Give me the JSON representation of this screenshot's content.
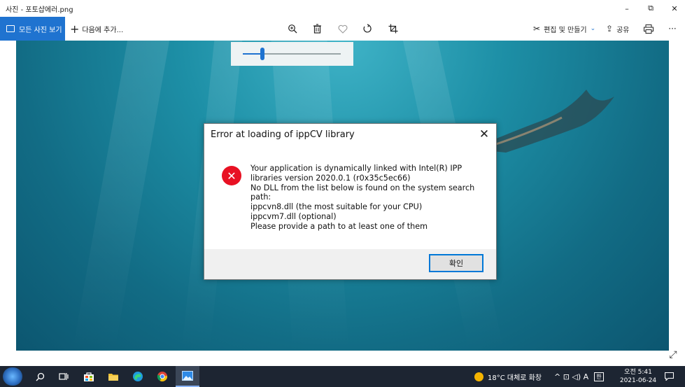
{
  "window": {
    "title": "사진 - 포토샵에러.png",
    "minimize_glyph": "–",
    "maximize_glyph": "⧉",
    "close_glyph": "✕"
  },
  "toolbar": {
    "all_photos_label": "모든 사진 보기",
    "add_to_label": "다음에 추가...",
    "edit_create_label": "편집 및 만들기",
    "share_label": "공유",
    "more_glyph": "···"
  },
  "zoom": {
    "level_fraction": 0.2
  },
  "dialog": {
    "title": "Error at loading of ippCV library",
    "close_glyph": "✕",
    "icon_glyph": "✕",
    "message_lines": [
      "Your application is dynamically linked with Intel(R) IPP",
      "libraries version 2020.0.1 (r0x35c5ec66)",
      "No DLL from the list below is found on the system search",
      "path:",
      "ippcvn8.dll (the most suitable for your CPU)",
      "ippcvm7.dll (optional)",
      "Please provide a path to at least one of them"
    ],
    "ok_label": "확인"
  },
  "expand_glyph": "⤢",
  "taskbar": {
    "weather_text": "18°C  대체로 화창",
    "tray_glyphs": "^  ⊡  ◁)  A",
    "time": "오전 5:41",
    "date": "2021-06-24"
  },
  "colors": {
    "accent": "#1f73d0",
    "error_red": "#e81123",
    "taskbar_bg": "#1d2532",
    "photo_water": "#1d8fa6"
  }
}
